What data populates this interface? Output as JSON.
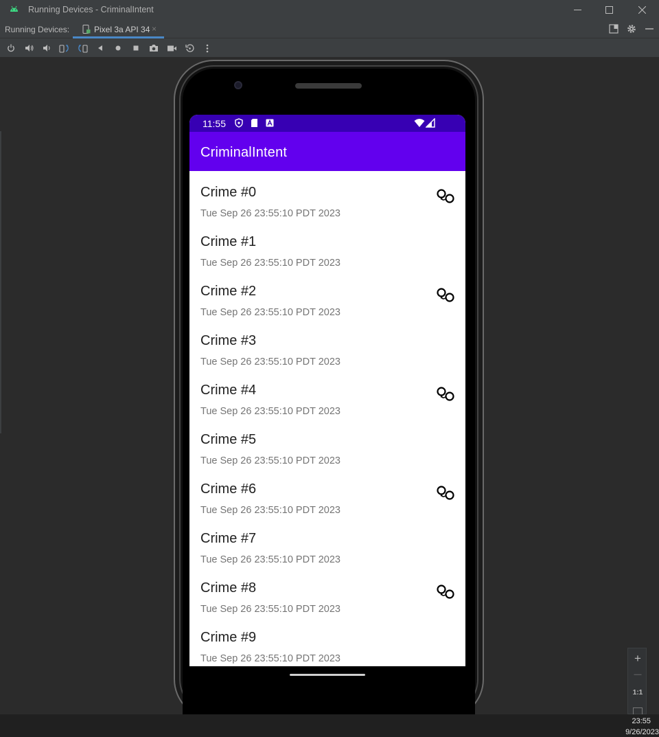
{
  "window": {
    "title": "Running Devices - CriminalIntent",
    "minimize": "—",
    "maximize": "☐",
    "close": "✕"
  },
  "tabbar": {
    "label": "Running Devices:",
    "tab_label": "Pixel 3a API 34",
    "tab_close": "×"
  },
  "device": {
    "status_time": "11:55",
    "app_title": "CriminalIntent"
  },
  "crimes": [
    {
      "title": "Crime #0",
      "date": "Tue Sep 26 23:55:10 PDT 2023",
      "solved": true
    },
    {
      "title": "Crime #1",
      "date": "Tue Sep 26 23:55:10 PDT 2023",
      "solved": false
    },
    {
      "title": "Crime #2",
      "date": "Tue Sep 26 23:55:10 PDT 2023",
      "solved": true
    },
    {
      "title": "Crime #3",
      "date": "Tue Sep 26 23:55:10 PDT 2023",
      "solved": false
    },
    {
      "title": "Crime #4",
      "date": "Tue Sep 26 23:55:10 PDT 2023",
      "solved": true
    },
    {
      "title": "Crime #5",
      "date": "Tue Sep 26 23:55:10 PDT 2023",
      "solved": false
    },
    {
      "title": "Crime #6",
      "date": "Tue Sep 26 23:55:10 PDT 2023",
      "solved": true
    },
    {
      "title": "Crime #7",
      "date": "Tue Sep 26 23:55:10 PDT 2023",
      "solved": false
    },
    {
      "title": "Crime #8",
      "date": "Tue Sep 26 23:55:10 PDT 2023",
      "solved": true
    },
    {
      "title": "Crime #9",
      "date": "Tue Sep 26 23:55:10 PDT 2023",
      "solved": false
    }
  ],
  "zoom": {
    "zoom_in": "+",
    "zoom_out": "—",
    "actual": "1:1"
  },
  "taskbar": {
    "clock": "23:55",
    "date": "9/26/2023"
  },
  "colors": {
    "status_bar": "#3700b3",
    "app_bar": "#6200ee",
    "tab_accent": "#4a88c7"
  }
}
